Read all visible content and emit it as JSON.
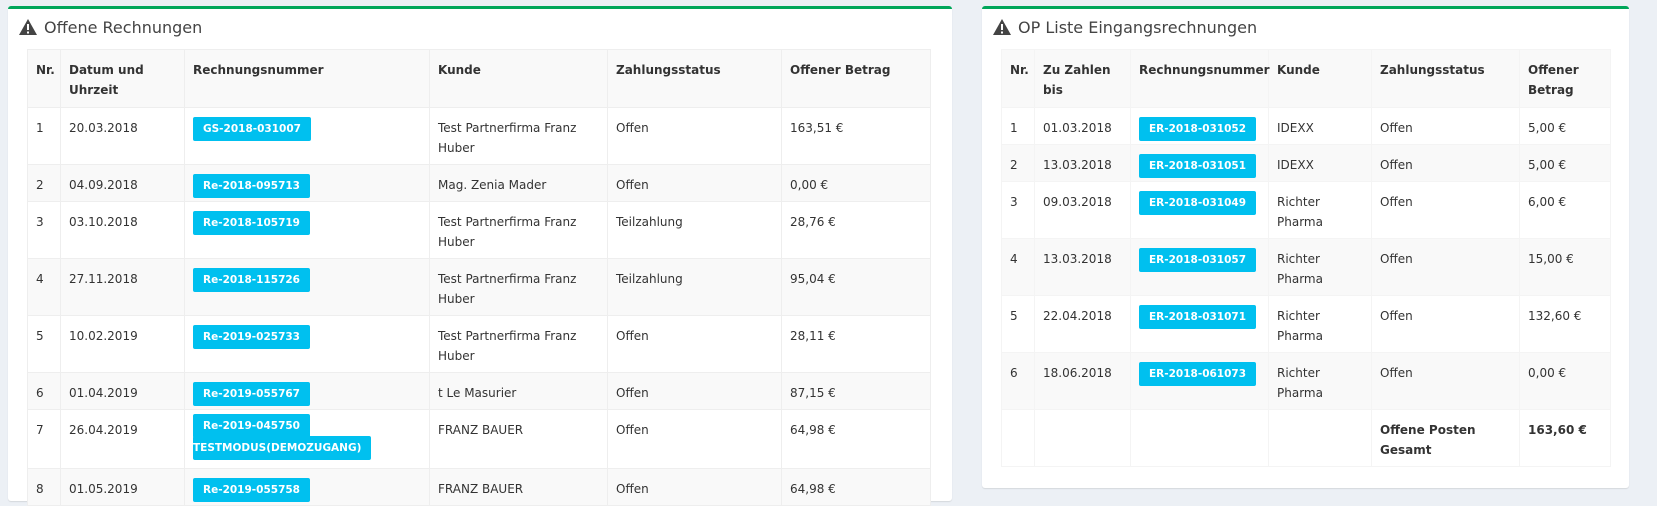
{
  "colors": {
    "accent": "#00a65a",
    "badge": "#00c0ef"
  },
  "left_panel": {
    "title": "Offene Rechnungen",
    "icon": "warning-icon",
    "headers": [
      "Nr.",
      "Datum und Uhrzeit",
      "Rechnungsnummer",
      "Kunde",
      "Zahlungsstatus",
      "Offener Betrag"
    ],
    "rows": [
      {
        "nr": "1",
        "datum": "20.03.2018",
        "rechnung": "GS-2018-031007",
        "kunde": "Test Partnerfirma Franz Huber",
        "status": "Offen",
        "betrag": "163,51 €"
      },
      {
        "nr": "2",
        "datum": "04.09.2018",
        "rechnung": "Re-2018-095713",
        "kunde": "Mag. Zenia Mader",
        "status": "Offen",
        "betrag": "0,00 €"
      },
      {
        "nr": "3",
        "datum": "03.10.2018",
        "rechnung": "Re-2018-105719",
        "kunde": "Test Partnerfirma Franz Huber",
        "status": "Teilzahlung",
        "betrag": "28,76 €"
      },
      {
        "nr": "4",
        "datum": "27.11.2018",
        "rechnung": "Re-2018-115726",
        "kunde": "Test Partnerfirma Franz Huber",
        "status": "Teilzahlung",
        "betrag": "95,04 €"
      },
      {
        "nr": "5",
        "datum": "10.02.2019",
        "rechnung": "Re-2019-025733",
        "kunde": "Test Partnerfirma Franz Huber",
        "status": "Offen",
        "betrag": "28,11 €"
      },
      {
        "nr": "6",
        "datum": "01.04.2019",
        "rechnung": "Re-2019-055767",
        "kunde": "t Le Masurier",
        "status": "Offen",
        "betrag": "87,15 €"
      },
      {
        "nr": "7",
        "datum": "26.04.2019",
        "rechnung": "Re-2019-045750",
        "rechnung2": "TESTMODUS(DEMOZUGANG)",
        "kunde": "FRANZ BAUER",
        "status": "Offen",
        "betrag": "64,98 €"
      },
      {
        "nr": "8",
        "datum": "01.05.2019",
        "rechnung": "Re-2019-055758",
        "kunde": "FRANZ BAUER",
        "status": "Offen",
        "betrag": "64,98 €"
      }
    ]
  },
  "right_panel": {
    "title": "OP Liste Eingangsrechnungen",
    "icon": "warning-icon",
    "headers": [
      "Nr.",
      "Zu Zahlen bis",
      "Rechnungsnummer",
      "Kunde",
      "Zahlungsstatus",
      "Offener Betrag"
    ],
    "rows": [
      {
        "nr": "1",
        "datum": "01.03.2018",
        "rechnung": "ER-2018-031052",
        "kunde": "IDEXX",
        "status": "Offen",
        "betrag": "5,00 €"
      },
      {
        "nr": "2",
        "datum": "13.03.2018",
        "rechnung": "ER-2018-031051",
        "kunde": "IDEXX",
        "status": "Offen",
        "betrag": "5,00 €"
      },
      {
        "nr": "3",
        "datum": "09.03.2018",
        "rechnung": "ER-2018-031049",
        "kunde": "Richter Pharma",
        "status": "Offen",
        "betrag": "6,00 €"
      },
      {
        "nr": "4",
        "datum": "13.03.2018",
        "rechnung": "ER-2018-031057",
        "kunde": "Richter Pharma",
        "status": "Offen",
        "betrag": "15,00 €"
      },
      {
        "nr": "5",
        "datum": "22.04.2018",
        "rechnung": "ER-2018-031071",
        "kunde": "Richter Pharma",
        "status": "Offen",
        "betrag": "132,60 €"
      },
      {
        "nr": "6",
        "datum": "18.06.2018",
        "rechnung": "ER-2018-061073",
        "kunde": "Richter Pharma",
        "status": "Offen",
        "betrag": "0,00 €"
      }
    ],
    "total_label": "Offene Posten Gesamt",
    "total_value": "163,60 €"
  }
}
